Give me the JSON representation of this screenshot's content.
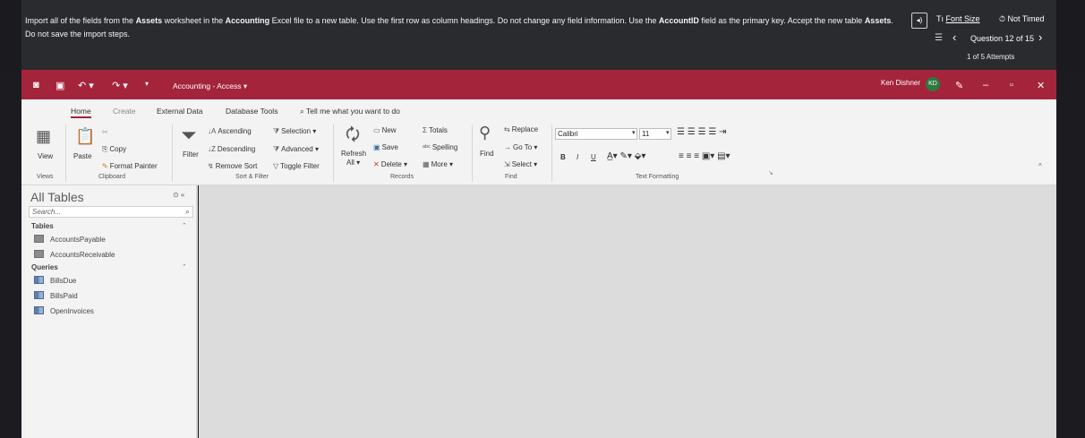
{
  "task": {
    "part1": "Import all of the fields from the ",
    "b1": "Assets",
    "part2": " worksheet in the ",
    "b2": "Accounting",
    "part3": " Excel file to a new table. Use the first row as column headings. Do not change any field information. Use the ",
    "b3": "AccountID",
    "part4": " field as the primary key. Accept the new table ",
    "b4": "Assets",
    "part5": ". Do not save the import steps.",
    "font_size_prefix": "Tı",
    "font_size": "Font Size",
    "not_timed": "Not Timed",
    "question": "Question 12 of 15",
    "attempts": "1 of 5 Attempts"
  },
  "titlebar": {
    "title": "Accounting - Access ▾",
    "user": "Ken Dishner",
    "initials": "KD"
  },
  "tabs": [
    "Home",
    "Create",
    "External Data",
    "Database Tools"
  ],
  "tell_me": "Tell me what you want to do",
  "ribbon": {
    "view": "View",
    "paste": "Paste",
    "copy": "Copy",
    "format_painter": "Format Painter",
    "filter": "Filter",
    "ascending": "Ascending",
    "descending": "Descending",
    "remove_sort": "Remove Sort",
    "selection": "Selection ▾",
    "advanced": "Advanced ▾",
    "toggle_filter": "Toggle Filter",
    "refresh": "Refresh",
    "refresh_all": "All ▾",
    "new": "New",
    "save": "Save",
    "delete": "Delete ▾",
    "totals": "Totals",
    "spelling": "Spelling",
    "more": "More ▾",
    "find": "Find",
    "replace": "Replace",
    "goto": "Go To ▾",
    "select": "Select ▾",
    "font": "Calibri",
    "font_size": "11",
    "groups": {
      "views": "Views",
      "clipboard": "Clipboard",
      "sort_filter": "Sort & Filter",
      "records": "Records",
      "find": "Find",
      "text_formatting": "Text Formatting"
    }
  },
  "nav": {
    "title": "All Tables",
    "search_placeholder": "Search...",
    "tables_header": "Tables",
    "tables": [
      "AccountsPayable",
      "AccountsReceivable"
    ],
    "queries_header": "Queries",
    "queries": [
      "BillsDue",
      "BillsPaid",
      "OpenInvoices"
    ]
  },
  "colors": {
    "title_bar": "#a4243b",
    "instruction_bg": "#2a2b2f"
  }
}
